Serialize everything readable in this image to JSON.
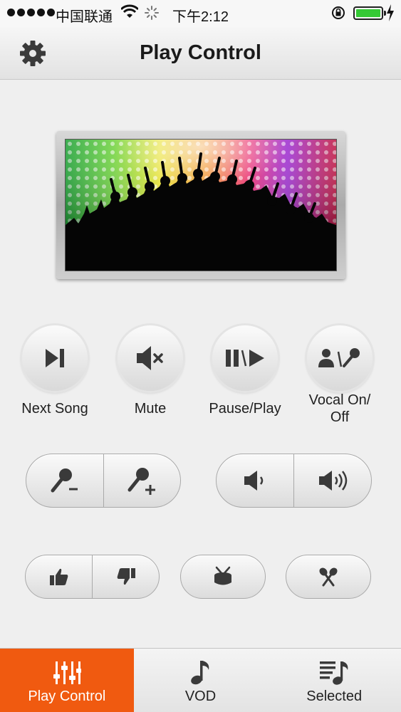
{
  "status_bar": {
    "carrier": "中国联通",
    "time": "下午2:12"
  },
  "header": {
    "title": "Play Control",
    "settings_icon": "gear-icon"
  },
  "hero": {
    "description_icon": "concert-crowd-image"
  },
  "controls": {
    "next_song_label": "Next Song",
    "mute_label": "Mute",
    "pause_play_label": "Pause/Play",
    "vocal_label_line1": "Vocal On/",
    "vocal_label_line2": "Off"
  },
  "tabs": [
    {
      "label": "Play Control",
      "icon": "mixer-sliders-icon",
      "active": true
    },
    {
      "label": "VOD",
      "icon": "music-note-icon",
      "active": false
    },
    {
      "label": "Selected",
      "icon": "playlist-icon",
      "active": false
    }
  ],
  "colors": {
    "accent": "#f05a10",
    "battery": "#35c935",
    "icon": "#3a3a3a"
  }
}
